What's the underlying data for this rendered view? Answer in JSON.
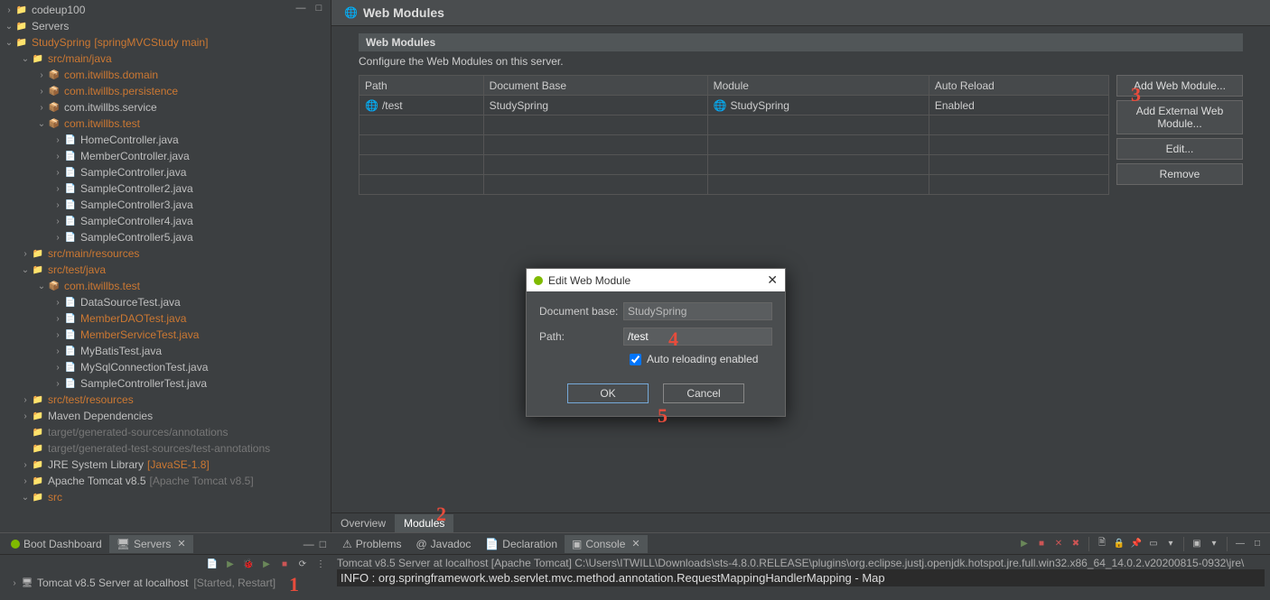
{
  "tree": {
    "items": [
      {
        "d": 0,
        "exp": ">",
        "ic": "folder-leaf",
        "label": "codeup100",
        "cls": ""
      },
      {
        "d": 0,
        "exp": "v",
        "ic": "folder-leaf",
        "label": "Servers",
        "cls": ""
      },
      {
        "d": 0,
        "exp": "v",
        "ic": "folder-leaf",
        "label": "StudySpring",
        "suffix": "[springMVCStudy main]",
        "cls": "label-orange",
        "suffixCls": "label-orange"
      },
      {
        "d": 1,
        "exp": "v",
        "ic": "folder-leaf",
        "label": "src/main/java",
        "cls": "label-orange"
      },
      {
        "d": 2,
        "exp": ">",
        "ic": "pkg-leaf",
        "label": "com.itwillbs.domain",
        "cls": "label-orange"
      },
      {
        "d": 2,
        "exp": ">",
        "ic": "pkg-leaf",
        "label": "com.itwillbs.persistence",
        "cls": "label-orange"
      },
      {
        "d": 2,
        "exp": ">",
        "ic": "pkg-leaf",
        "label": "com.itwillbs.service",
        "cls": ""
      },
      {
        "d": 2,
        "exp": "v",
        "ic": "pkg-leaf",
        "label": "com.itwillbs.test",
        "cls": "label-orange"
      },
      {
        "d": 3,
        "exp": ">",
        "ic": "proj-leaf-icon",
        "label": "HomeController.java",
        "cls": ""
      },
      {
        "d": 3,
        "exp": ">",
        "ic": "proj-leaf-icon",
        "label": "MemberController.java",
        "cls": ""
      },
      {
        "d": 3,
        "exp": ">",
        "ic": "proj-leaf-icon",
        "label": "SampleController.java",
        "cls": ""
      },
      {
        "d": 3,
        "exp": ">",
        "ic": "proj-leaf-icon",
        "label": "SampleController2.java",
        "cls": ""
      },
      {
        "d": 3,
        "exp": ">",
        "ic": "proj-leaf-icon",
        "label": "SampleController3.java",
        "cls": ""
      },
      {
        "d": 3,
        "exp": ">",
        "ic": "proj-leaf-icon",
        "label": "SampleController4.java",
        "cls": ""
      },
      {
        "d": 3,
        "exp": ">",
        "ic": "proj-leaf-icon",
        "label": "SampleController5.java",
        "cls": ""
      },
      {
        "d": 1,
        "exp": ">",
        "ic": "folder-leaf",
        "label": "src/main/resources",
        "cls": "label-orange"
      },
      {
        "d": 1,
        "exp": "v",
        "ic": "folder-leaf",
        "label": "src/test/java",
        "cls": "label-orange"
      },
      {
        "d": 2,
        "exp": "v",
        "ic": "pkg-leaf",
        "label": "com.itwillbs.test",
        "cls": "label-orange"
      },
      {
        "d": 3,
        "exp": ">",
        "ic": "proj-leaf-icon",
        "label": "DataSourceTest.java",
        "cls": ""
      },
      {
        "d": 3,
        "exp": ">",
        "ic": "proj-leaf-icon",
        "label": "MemberDAOTest.java",
        "cls": "label-orange"
      },
      {
        "d": 3,
        "exp": ">",
        "ic": "proj-leaf-icon",
        "label": "MemberServiceTest.java",
        "cls": "label-orange"
      },
      {
        "d": 3,
        "exp": ">",
        "ic": "proj-leaf-icon",
        "label": "MyBatisTest.java",
        "cls": ""
      },
      {
        "d": 3,
        "exp": ">",
        "ic": "proj-leaf-icon",
        "label": "MySqlConnectionTest.java",
        "cls": ""
      },
      {
        "d": 3,
        "exp": ">",
        "ic": "proj-leaf-icon",
        "label": "SampleControllerTest.java",
        "cls": ""
      },
      {
        "d": 1,
        "exp": ">",
        "ic": "folder-leaf",
        "label": "src/test/resources",
        "cls": "label-orange"
      },
      {
        "d": 1,
        "exp": ">",
        "ic": "folder-leaf",
        "label": "Maven Dependencies",
        "cls": ""
      },
      {
        "d": 1,
        "exp": "",
        "ic": "folder-leaf",
        "label": "target/generated-sources/annotations",
        "cls": "label-gray"
      },
      {
        "d": 1,
        "exp": "",
        "ic": "folder-leaf",
        "label": "target/generated-test-sources/test-annotations",
        "cls": "label-gray"
      },
      {
        "d": 1,
        "exp": ">",
        "ic": "folder-leaf",
        "label": "JRE System Library",
        "suffix": "[JavaSE-1.8]",
        "suffixCls": "label-orange"
      },
      {
        "d": 1,
        "exp": ">",
        "ic": "folder-leaf",
        "label": "Apache Tomcat v8.5",
        "suffix": "[Apache Tomcat v8.5]",
        "suffixCls": ""
      },
      {
        "d": 1,
        "exp": "v",
        "ic": "folder-leaf",
        "label": "src",
        "cls": "label-orange"
      }
    ]
  },
  "bottomLeft": {
    "tabs": [
      {
        "label": "Boot Dashboard",
        "active": false
      },
      {
        "label": "Servers",
        "active": true
      }
    ],
    "server": {
      "name": "Tomcat v8.5 Server at localhost",
      "status": "[Started, Restart]"
    }
  },
  "webModules": {
    "headerTitle": "Web Modules",
    "subTitle": "Web Modules",
    "subDesc": "Configure the Web Modules on this server.",
    "columns": [
      "Path",
      "Document Base",
      "Module",
      "Auto Reload"
    ],
    "rows": [
      {
        "path": "/test",
        "docBase": "StudySpring",
        "module": "StudySpring",
        "autoReload": "Enabled"
      }
    ],
    "emptyRows": 4,
    "buttons": [
      "Add Web Module...",
      "Add External Web Module...",
      "Edit...",
      "Remove"
    ]
  },
  "editorTabs": [
    {
      "label": "Overview",
      "active": false
    },
    {
      "label": "Modules",
      "active": true
    }
  ],
  "dialog": {
    "title": "Edit Web Module",
    "docBaseLabel": "Document base:",
    "docBaseValue": "StudySpring",
    "pathLabel": "Path:",
    "pathValue": "/test",
    "checkLabel": "Auto reloading enabled",
    "checked": true,
    "okLabel": "OK",
    "cancelLabel": "Cancel"
  },
  "console": {
    "tabs": [
      {
        "label": "Problems",
        "active": false
      },
      {
        "label": "Javadoc",
        "active": false
      },
      {
        "label": "Declaration",
        "active": false
      },
      {
        "label": "Console",
        "active": true
      }
    ],
    "line1": "Tomcat v8.5 Server at localhost [Apache Tomcat] C:\\Users\\ITWILL\\Downloads\\sts-4.8.0.RELEASE\\plugins\\org.eclipse.justj.openjdk.hotspot.jre.full.win32.x86_64_14.0.2.v20200815-0932\\jre\\",
    "line2": "INFO : org.springframework.web.servlet.mvc.method.annotation.RequestMappingHandlerMapping - Map"
  },
  "annotations": {
    "a1": "1",
    "a2": "2",
    "a3": "3",
    "a4": "4",
    "a5": "5"
  }
}
